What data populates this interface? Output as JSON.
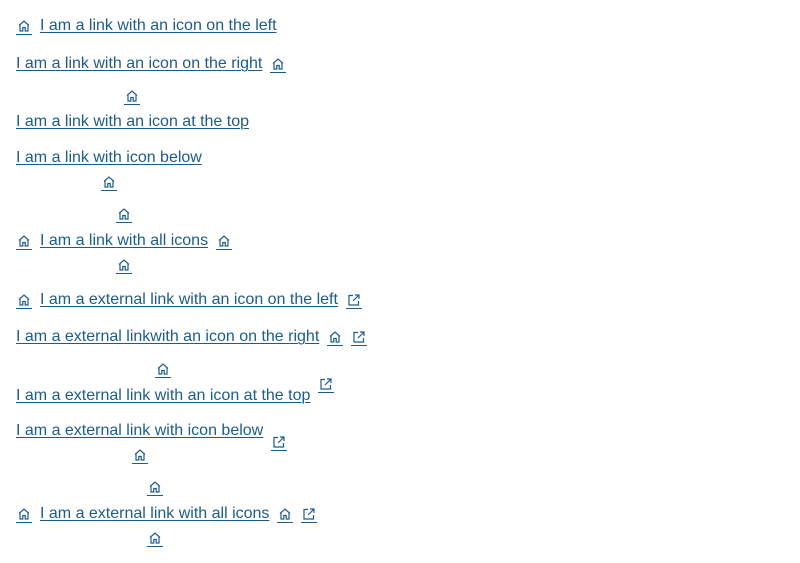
{
  "links": {
    "icon_left": "I am a link with an icon on the left",
    "icon_right": "I am a link with an icon on the right",
    "icon_top": "I am a link with an icon at the top",
    "icon_below": "I am a link with icon below",
    "all_icons": "I am a link with all icons",
    "ext_icon_left": "I am a external link with an icon on the left",
    "ext_icon_right": "I am a external linkwith an icon on the right",
    "ext_icon_top": "I am a external link with an icon at the top",
    "ext_icon_below": "I am a external link with icon below",
    "ext_all_icons": "I am a external link with all icons"
  },
  "icons": {
    "home": "home-icon",
    "external": "external-link-icon"
  },
  "colors": {
    "link": "#1d5c8a"
  }
}
